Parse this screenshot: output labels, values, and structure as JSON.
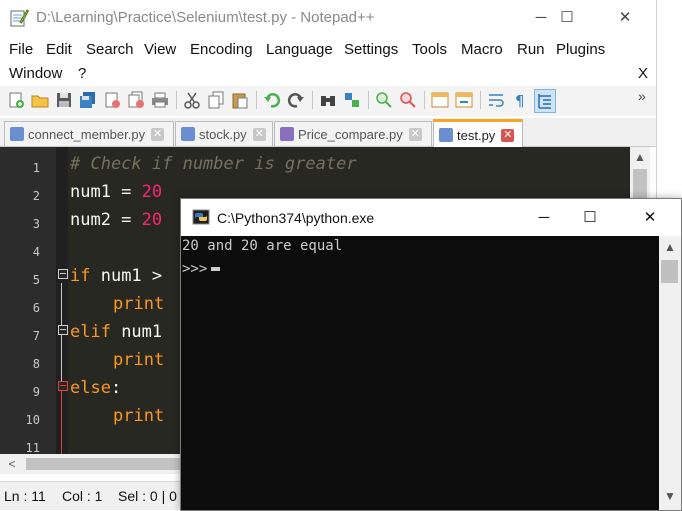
{
  "npp": {
    "title": "D:\\Learning\\Practice\\Selenium\\test.py - Notepad++",
    "window_buttons": {
      "minimize": "─",
      "maximize": "☐",
      "close": "✕"
    },
    "menu": [
      "File",
      "Edit",
      "Search",
      "View",
      "Encoding",
      "Language",
      "Settings",
      "Tools",
      "Macro",
      "Run",
      "Plugins",
      "Window",
      "?"
    ],
    "menu_close": "X",
    "toolbar_more": "»",
    "tabs": [
      {
        "label": "connect_member.py",
        "active": false
      },
      {
        "label": "stock.py",
        "active": false
      },
      {
        "label": "Price_compare.py",
        "active": false
      },
      {
        "label": "test.py",
        "active": true
      }
    ],
    "tab_close": "✕",
    "line_numbers": [
      "1",
      "2",
      "3",
      "4",
      "5",
      "6",
      "7",
      "8",
      "9",
      "10",
      "11"
    ],
    "code": {
      "l1_comment": "# Check if number is greater",
      "l2_var": "num1 = ",
      "l2_num": "20",
      "l3_var": "num2 = ",
      "l3_num": "20",
      "l5_kw": "if",
      "l5_rest": " num1 >",
      "l6_kw": "print",
      "l7_kw": "elif",
      "l7_rest": " num1",
      "l8_kw": "print",
      "l9_kw": "else",
      "l9_rest": ":",
      "l10_kw": "print"
    },
    "scroll_arrows": {
      "up": "▲",
      "down": "▼",
      "left": "<",
      "right": ">"
    },
    "status": {
      "ln": "Ln : 11",
      "col": "Col : 1",
      "sel": "Sel : 0 | 0"
    }
  },
  "console": {
    "title": "C:\\Python374\\python.exe",
    "window_buttons": {
      "minimize": "─",
      "maximize": "☐",
      "close": "✕"
    },
    "output_line": "20 and 20 are equal",
    "prompt": ">>>",
    "scroll_arrows": {
      "up": "▲",
      "down": "▼"
    }
  },
  "colors": {
    "editor_bg": "#272822",
    "comment": "#75715e",
    "number": "#f92672",
    "keyword": "#fd971f",
    "active_tab_accent": "#f5a623",
    "console_bg": "#0c0c0c"
  }
}
